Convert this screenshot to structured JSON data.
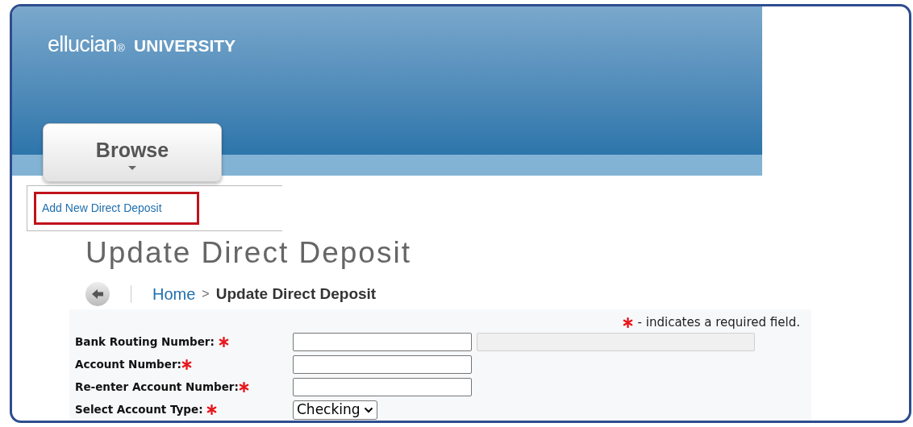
{
  "header": {
    "logo": "ellucian",
    "registered": "®",
    "subtitle": "UNIVERSITY",
    "menu": [
      {
        "label": "Browse",
        "selected": true
      }
    ]
  },
  "side_link": {
    "label": "Add New Direct Deposit",
    "highlighted": true
  },
  "page_title": "Update Direct Deposit",
  "breadcrumb": {
    "home": "Home",
    "separator": ">",
    "current": "Update Direct Deposit"
  },
  "form": {
    "required_note": "- indicates a required field.",
    "fields": [
      {
        "label": "Bank Routing Number: ",
        "required": true,
        "inputs": [
          {
            "kind": "text",
            "disabled": false
          },
          {
            "kind": "text",
            "disabled": true
          }
        ]
      },
      {
        "label": "Account Number:",
        "required": true,
        "inputs": [
          {
            "kind": "text",
            "disabled": false
          }
        ]
      },
      {
        "label": "Re-enter Account Number:",
        "required": true,
        "inputs": [
          {
            "kind": "text",
            "disabled": false
          }
        ]
      },
      {
        "label": "Select Account Type: ",
        "required": true,
        "inputs": [
          {
            "kind": "select",
            "value": "Checking",
            "disabled": false
          }
        ]
      }
    ]
  }
}
